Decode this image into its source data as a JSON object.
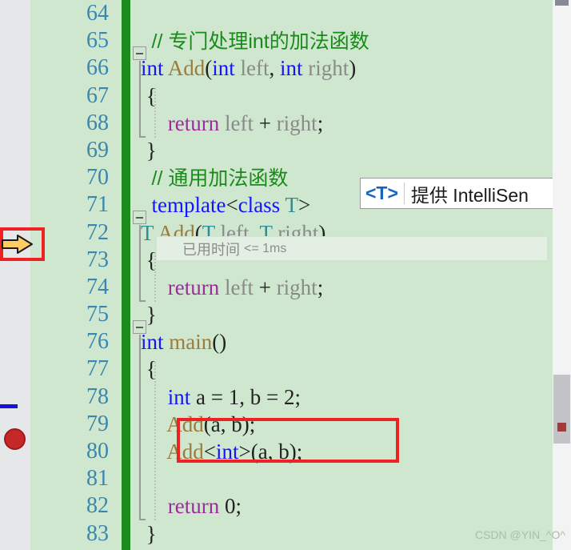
{
  "editor": {
    "first_line": 64,
    "line_numbers": [
      64,
      65,
      66,
      67,
      68,
      69,
      70,
      71,
      72,
      73,
      74,
      75,
      76,
      77,
      78,
      79,
      80,
      81,
      82,
      83
    ],
    "colors": {
      "background": "#cfe7cf",
      "line_number": "#3a87ad",
      "change_bar_saved": "#1c8a1c",
      "keyword": "#1414ff",
      "comment": "#1a8a1a",
      "control": "#9b2d9b",
      "function": "#9c7b3c",
      "type_param": "#2b8f9a",
      "identifier": "#8a8a8a",
      "highlight_box": "#ee2222",
      "breakpoint": "#c62828"
    },
    "lines": [
      {
        "num": 64,
        "segments": []
      },
      {
        "num": 65,
        "segments": [
          {
            "text": "  ",
            "cls": "t-plain"
          },
          {
            "text": "// 专门处理int的加法函数",
            "cls": "t-comment"
          }
        ]
      },
      {
        "num": 66,
        "segments": [
          {
            "text": "int",
            "cls": "t-key"
          },
          {
            "text": " ",
            "cls": "t-plain"
          },
          {
            "text": "Add",
            "cls": "t-fn"
          },
          {
            "text": "(",
            "cls": "t-punct"
          },
          {
            "text": "int",
            "cls": "t-key"
          },
          {
            "text": " ",
            "cls": "t-plain"
          },
          {
            "text": "left",
            "cls": "t-id"
          },
          {
            "text": ", ",
            "cls": "t-punct"
          },
          {
            "text": "int",
            "cls": "t-key"
          },
          {
            "text": " ",
            "cls": "t-plain"
          },
          {
            "text": "right",
            "cls": "t-id"
          },
          {
            "text": ")",
            "cls": "t-punct"
          }
        ]
      },
      {
        "num": 67,
        "segments": [
          {
            "text": " {",
            "cls": "t-punct"
          }
        ]
      },
      {
        "num": 68,
        "segments": [
          {
            "text": "     ",
            "cls": "t-plain"
          },
          {
            "text": "return",
            "cls": "t-ctrl"
          },
          {
            "text": " ",
            "cls": "t-plain"
          },
          {
            "text": "left",
            "cls": "t-id"
          },
          {
            "text": " + ",
            "cls": "t-punct"
          },
          {
            "text": "right",
            "cls": "t-id"
          },
          {
            "text": ";",
            "cls": "t-punct"
          }
        ]
      },
      {
        "num": 69,
        "segments": [
          {
            "text": " }",
            "cls": "t-punct"
          }
        ]
      },
      {
        "num": 70,
        "segments": [
          {
            "text": "  ",
            "cls": "t-plain"
          },
          {
            "text": "// 通用加法函数",
            "cls": "t-comment"
          }
        ]
      },
      {
        "num": 71,
        "segments": [
          {
            "text": "  ",
            "cls": "t-plain"
          },
          {
            "text": "template",
            "cls": "t-key"
          },
          {
            "text": "<",
            "cls": "t-punct"
          },
          {
            "text": "class",
            "cls": "t-key"
          },
          {
            "text": " ",
            "cls": "t-plain"
          },
          {
            "text": "T",
            "cls": "t-type"
          },
          {
            "text": ">",
            "cls": "t-punct"
          }
        ]
      },
      {
        "num": 72,
        "segments": [
          {
            "text": "T",
            "cls": "t-type"
          },
          {
            "text": " ",
            "cls": "t-plain"
          },
          {
            "text": "Add",
            "cls": "t-fn"
          },
          {
            "text": "(",
            "cls": "t-punct"
          },
          {
            "text": "T",
            "cls": "t-type"
          },
          {
            "text": " ",
            "cls": "t-plain"
          },
          {
            "text": "left",
            "cls": "t-id"
          },
          {
            "text": ", ",
            "cls": "t-punct"
          },
          {
            "text": "T",
            "cls": "t-type"
          },
          {
            "text": " ",
            "cls": "t-plain"
          },
          {
            "text": "right",
            "cls": "t-id"
          },
          {
            "text": ")",
            "cls": "t-punct"
          }
        ]
      },
      {
        "num": 73,
        "segments": [
          {
            "text": " {",
            "cls": "t-punct"
          }
        ]
      },
      {
        "num": 74,
        "segments": [
          {
            "text": "     ",
            "cls": "t-plain"
          },
          {
            "text": "return",
            "cls": "t-ctrl"
          },
          {
            "text": " ",
            "cls": "t-plain"
          },
          {
            "text": "left",
            "cls": "t-id"
          },
          {
            "text": " + ",
            "cls": "t-punct"
          },
          {
            "text": "right",
            "cls": "t-id"
          },
          {
            "text": ";",
            "cls": "t-punct"
          }
        ]
      },
      {
        "num": 75,
        "segments": [
          {
            "text": " }",
            "cls": "t-punct"
          }
        ]
      },
      {
        "num": 76,
        "segments": [
          {
            "text": "int",
            "cls": "t-key"
          },
          {
            "text": " ",
            "cls": "t-plain"
          },
          {
            "text": "main",
            "cls": "t-fn"
          },
          {
            "text": "()",
            "cls": "t-punct"
          }
        ]
      },
      {
        "num": 77,
        "segments": [
          {
            "text": " {",
            "cls": "t-punct"
          }
        ]
      },
      {
        "num": 78,
        "segments": [
          {
            "text": "     ",
            "cls": "t-plain"
          },
          {
            "text": "int",
            "cls": "t-key"
          },
          {
            "text": " a = 1, b = 2;",
            "cls": "t-plain"
          }
        ]
      },
      {
        "num": 79,
        "segments": [
          {
            "text": "     ",
            "cls": "t-plain"
          },
          {
            "text": "Add",
            "cls": "t-fn"
          },
          {
            "text": "(a, b);",
            "cls": "t-punct"
          }
        ]
      },
      {
        "num": 80,
        "segments": [
          {
            "text": "     ",
            "cls": "t-plain"
          },
          {
            "text": "Add",
            "cls": "t-fn"
          },
          {
            "text": "<",
            "cls": "t-punct"
          },
          {
            "text": "int",
            "cls": "t-key"
          },
          {
            "text": ">",
            "cls": "t-punct"
          },
          {
            "text": "(a, b);",
            "cls": "t-punct"
          }
        ]
      },
      {
        "num": 81,
        "segments": []
      },
      {
        "num": 82,
        "segments": [
          {
            "text": "     ",
            "cls": "t-plain"
          },
          {
            "text": "return",
            "cls": "t-ctrl"
          },
          {
            "text": " 0;",
            "cls": "t-plain"
          }
        ]
      },
      {
        "num": 83,
        "segments": [
          {
            "text": " }",
            "cls": "t-punct"
          }
        ]
      }
    ]
  },
  "intellisense_tooltip": {
    "type_param": "<T>",
    "description": "提供 IntelliSen"
  },
  "elapsed_hint": {
    "label": "已用时间",
    "value": "<= 1ms"
  },
  "debug_margin": {
    "current_line_arrow": "execution-pointer-arrow",
    "breakpoint_line": 80
  },
  "annotations": {
    "arrow_callout_color": "#ee2222",
    "highlight_box_color": "#ee2222"
  },
  "scrollbar": {
    "up_arrow": "scroll-up-arrow",
    "blue_marker": "#1414dd",
    "red_marker": "#a13b3b"
  },
  "watermark": "CSDN @YIN_^O^"
}
